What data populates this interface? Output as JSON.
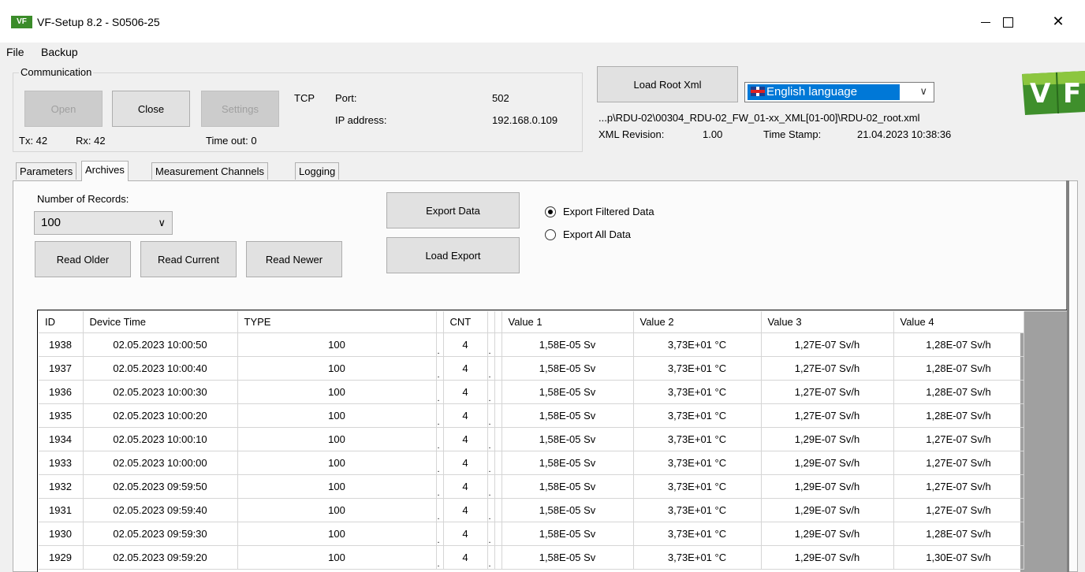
{
  "window": {
    "title": "VF-Setup 8.2 - S0506-25",
    "icon_text": "VF",
    "controls": [
      "minimize",
      "maximize",
      "close"
    ]
  },
  "menu": {
    "items": [
      "File",
      "Backup"
    ]
  },
  "communication": {
    "group_label": "Communication",
    "open_label": "Open",
    "close_label": "Close",
    "settings_label": "Settings",
    "protocol": "TCP",
    "port_label": "Port:",
    "port_value": "502",
    "ip_label": "IP address:",
    "ip_value": "192.168.0.109",
    "tx": "Tx: 42",
    "rx": "Rx: 42",
    "timeout": "Time out: 0"
  },
  "xml": {
    "load_root_label": "Load Root Xml",
    "language": "English language",
    "path": "...p\\RDU-02\\00304_RDU-02_FW_01-xx_XML[01-00]\\RDU-02_root.xml",
    "revision_label": "XML Revision:",
    "revision_value": "1.00",
    "timestamp_label": "Time Stamp:",
    "timestamp_value": "21.04.2023 10:38:36"
  },
  "logo_text": "VF",
  "tabs": [
    {
      "label": "Parameters",
      "active": false
    },
    {
      "label": "Archives",
      "active": true
    },
    {
      "label": "Measurement Channels",
      "active": false
    },
    {
      "label": "Logging",
      "active": false
    }
  ],
  "archives": {
    "records_label": "Number of Records:",
    "records_value": "100",
    "read_older": "Read Older",
    "read_current": "Read Current",
    "read_newer": "Read Newer",
    "export_data": "Export Data",
    "load_export": "Load Export",
    "export_filtered": "Export Filtered Data",
    "export_all": "Export All Data",
    "export_mode": "filtered"
  },
  "grid": {
    "columns": [
      "ID",
      "Device Time",
      "TYPE",
      "",
      "CNT",
      "",
      "",
      "Value 1",
      "Value 2",
      "Value 3",
      "Value 4"
    ],
    "rows": [
      [
        "1938",
        "02.05.2023 10:00:50",
        "100",
        "4",
        "1,58E-05 Sv",
        "3,73E+01 °C",
        "1,27E-07 Sv/h",
        "1,28E-07 Sv/h"
      ],
      [
        "1937",
        "02.05.2023 10:00:40",
        "100",
        "4",
        "1,58E-05 Sv",
        "3,73E+01 °C",
        "1,27E-07 Sv/h",
        "1,28E-07 Sv/h"
      ],
      [
        "1936",
        "02.05.2023 10:00:30",
        "100",
        "4",
        "1,58E-05 Sv",
        "3,73E+01 °C",
        "1,27E-07 Sv/h",
        "1,28E-07 Sv/h"
      ],
      [
        "1935",
        "02.05.2023 10:00:20",
        "100",
        "4",
        "1,58E-05 Sv",
        "3,73E+01 °C",
        "1,27E-07 Sv/h",
        "1,28E-07 Sv/h"
      ],
      [
        "1934",
        "02.05.2023 10:00:10",
        "100",
        "4",
        "1,58E-05 Sv",
        "3,73E+01 °C",
        "1,29E-07 Sv/h",
        "1,27E-07 Sv/h"
      ],
      [
        "1933",
        "02.05.2023 10:00:00",
        "100",
        "4",
        "1,58E-05 Sv",
        "3,73E+01 °C",
        "1,29E-07 Sv/h",
        "1,27E-07 Sv/h"
      ],
      [
        "1932",
        "02.05.2023 09:59:50",
        "100",
        "4",
        "1,58E-05 Sv",
        "3,73E+01 °C",
        "1,29E-07 Sv/h",
        "1,27E-07 Sv/h"
      ],
      [
        "1931",
        "02.05.2023 09:59:40",
        "100",
        "4",
        "1,58E-05 Sv",
        "3,73E+01 °C",
        "1,29E-07 Sv/h",
        "1,27E-07 Sv/h"
      ],
      [
        "1930",
        "02.05.2023 09:59:30",
        "100",
        "4",
        "1,58E-05 Sv",
        "3,73E+01 °C",
        "1,29E-07 Sv/h",
        "1,28E-07 Sv/h"
      ],
      [
        "1929",
        "02.05.2023 09:59:20",
        "100",
        "4",
        "1,58E-05 Sv",
        "3,73E+01 °C",
        "1,29E-07 Sv/h",
        "1,30E-07 Sv/h"
      ]
    ]
  }
}
